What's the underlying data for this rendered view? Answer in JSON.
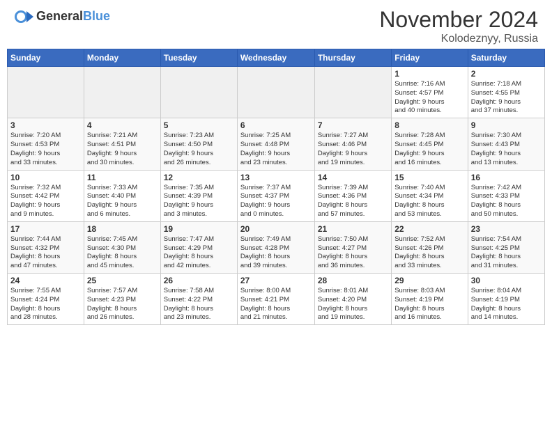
{
  "header": {
    "logo_line1": "General",
    "logo_line2": "Blue",
    "month": "November 2024",
    "location": "Kolodeznyy, Russia"
  },
  "weekdays": [
    "Sunday",
    "Monday",
    "Tuesday",
    "Wednesday",
    "Thursday",
    "Friday",
    "Saturday"
  ],
  "weeks": [
    [
      {
        "num": "",
        "info": ""
      },
      {
        "num": "",
        "info": ""
      },
      {
        "num": "",
        "info": ""
      },
      {
        "num": "",
        "info": ""
      },
      {
        "num": "",
        "info": ""
      },
      {
        "num": "1",
        "info": "Sunrise: 7:16 AM\nSunset: 4:57 PM\nDaylight: 9 hours\nand 40 minutes."
      },
      {
        "num": "2",
        "info": "Sunrise: 7:18 AM\nSunset: 4:55 PM\nDaylight: 9 hours\nand 37 minutes."
      }
    ],
    [
      {
        "num": "3",
        "info": "Sunrise: 7:20 AM\nSunset: 4:53 PM\nDaylight: 9 hours\nand 33 minutes."
      },
      {
        "num": "4",
        "info": "Sunrise: 7:21 AM\nSunset: 4:51 PM\nDaylight: 9 hours\nand 30 minutes."
      },
      {
        "num": "5",
        "info": "Sunrise: 7:23 AM\nSunset: 4:50 PM\nDaylight: 9 hours\nand 26 minutes."
      },
      {
        "num": "6",
        "info": "Sunrise: 7:25 AM\nSunset: 4:48 PM\nDaylight: 9 hours\nand 23 minutes."
      },
      {
        "num": "7",
        "info": "Sunrise: 7:27 AM\nSunset: 4:46 PM\nDaylight: 9 hours\nand 19 minutes."
      },
      {
        "num": "8",
        "info": "Sunrise: 7:28 AM\nSunset: 4:45 PM\nDaylight: 9 hours\nand 16 minutes."
      },
      {
        "num": "9",
        "info": "Sunrise: 7:30 AM\nSunset: 4:43 PM\nDaylight: 9 hours\nand 13 minutes."
      }
    ],
    [
      {
        "num": "10",
        "info": "Sunrise: 7:32 AM\nSunset: 4:42 PM\nDaylight: 9 hours\nand 9 minutes."
      },
      {
        "num": "11",
        "info": "Sunrise: 7:33 AM\nSunset: 4:40 PM\nDaylight: 9 hours\nand 6 minutes."
      },
      {
        "num": "12",
        "info": "Sunrise: 7:35 AM\nSunset: 4:39 PM\nDaylight: 9 hours\nand 3 minutes."
      },
      {
        "num": "13",
        "info": "Sunrise: 7:37 AM\nSunset: 4:37 PM\nDaylight: 9 hours\nand 0 minutes."
      },
      {
        "num": "14",
        "info": "Sunrise: 7:39 AM\nSunset: 4:36 PM\nDaylight: 8 hours\nand 57 minutes."
      },
      {
        "num": "15",
        "info": "Sunrise: 7:40 AM\nSunset: 4:34 PM\nDaylight: 8 hours\nand 53 minutes."
      },
      {
        "num": "16",
        "info": "Sunrise: 7:42 AM\nSunset: 4:33 PM\nDaylight: 8 hours\nand 50 minutes."
      }
    ],
    [
      {
        "num": "17",
        "info": "Sunrise: 7:44 AM\nSunset: 4:32 PM\nDaylight: 8 hours\nand 47 minutes."
      },
      {
        "num": "18",
        "info": "Sunrise: 7:45 AM\nSunset: 4:30 PM\nDaylight: 8 hours\nand 45 minutes."
      },
      {
        "num": "19",
        "info": "Sunrise: 7:47 AM\nSunset: 4:29 PM\nDaylight: 8 hours\nand 42 minutes."
      },
      {
        "num": "20",
        "info": "Sunrise: 7:49 AM\nSunset: 4:28 PM\nDaylight: 8 hours\nand 39 minutes."
      },
      {
        "num": "21",
        "info": "Sunrise: 7:50 AM\nSunset: 4:27 PM\nDaylight: 8 hours\nand 36 minutes."
      },
      {
        "num": "22",
        "info": "Sunrise: 7:52 AM\nSunset: 4:26 PM\nDaylight: 8 hours\nand 33 minutes."
      },
      {
        "num": "23",
        "info": "Sunrise: 7:54 AM\nSunset: 4:25 PM\nDaylight: 8 hours\nand 31 minutes."
      }
    ],
    [
      {
        "num": "24",
        "info": "Sunrise: 7:55 AM\nSunset: 4:24 PM\nDaylight: 8 hours\nand 28 minutes."
      },
      {
        "num": "25",
        "info": "Sunrise: 7:57 AM\nSunset: 4:23 PM\nDaylight: 8 hours\nand 26 minutes."
      },
      {
        "num": "26",
        "info": "Sunrise: 7:58 AM\nSunset: 4:22 PM\nDaylight: 8 hours\nand 23 minutes."
      },
      {
        "num": "27",
        "info": "Sunrise: 8:00 AM\nSunset: 4:21 PM\nDaylight: 8 hours\nand 21 minutes."
      },
      {
        "num": "28",
        "info": "Sunrise: 8:01 AM\nSunset: 4:20 PM\nDaylight: 8 hours\nand 19 minutes."
      },
      {
        "num": "29",
        "info": "Sunrise: 8:03 AM\nSunset: 4:19 PM\nDaylight: 8 hours\nand 16 minutes."
      },
      {
        "num": "30",
        "info": "Sunrise: 8:04 AM\nSunset: 4:19 PM\nDaylight: 8 hours\nand 14 minutes."
      }
    ]
  ]
}
